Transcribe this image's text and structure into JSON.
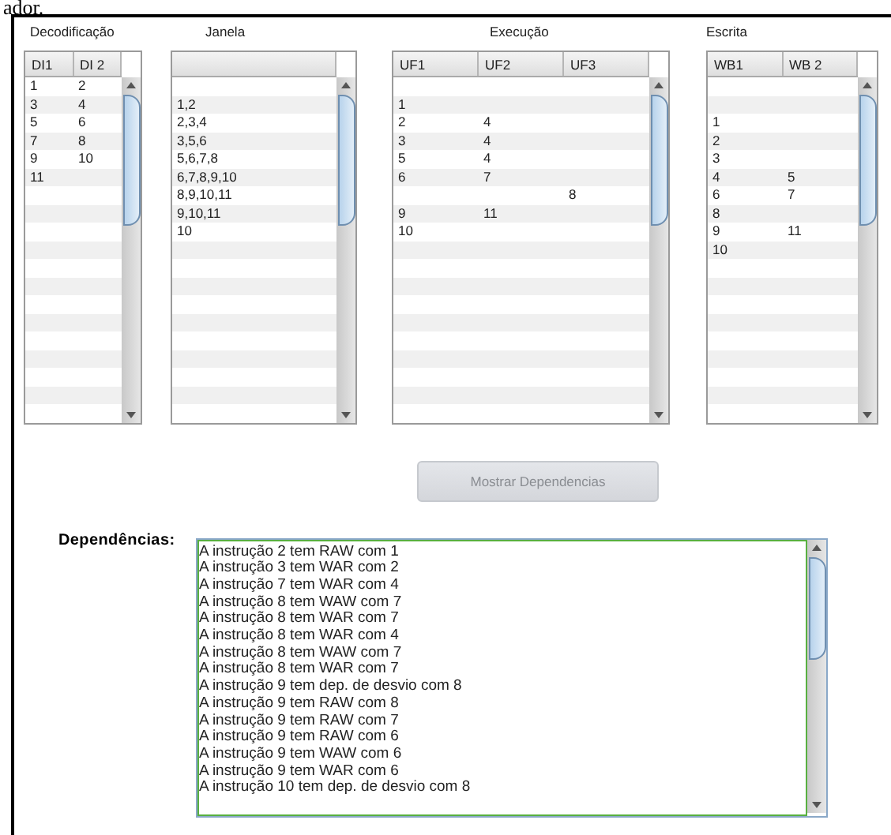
{
  "page_caption": "ador.",
  "tables": [
    {
      "caption": "Decodificação",
      "columns": [
        "DI1",
        "DI 2"
      ],
      "rows": [
        [
          "1",
          "2"
        ],
        [
          "3",
          "4"
        ],
        [
          "5",
          "6"
        ],
        [
          "7",
          "8"
        ],
        [
          "9",
          "10"
        ],
        [
          "11",
          null
        ]
      ]
    },
    {
      "caption": "Janela",
      "rows": [
        [
          null
        ],
        [
          "1,2"
        ],
        [
          "2,3,4"
        ],
        [
          "3,5,6"
        ],
        [
          "5,6,7,8"
        ],
        [
          "6,7,8,9,10"
        ],
        [
          "8,9,10,11"
        ],
        [
          "9,10,11"
        ],
        [
          "10"
        ]
      ]
    },
    {
      "caption": "Execução",
      "columns": [
        "UF1",
        "UF2",
        "UF3"
      ],
      "rows": [
        [
          null,
          null,
          null
        ],
        [
          "1",
          null,
          null
        ],
        [
          "2",
          "4",
          null
        ],
        [
          "3",
          "4",
          null
        ],
        [
          "5",
          "4",
          null
        ],
        [
          "6",
          "7",
          null
        ],
        [
          null,
          null,
          "8"
        ],
        [
          "9",
          "11",
          null
        ],
        [
          "10",
          null,
          null
        ]
      ]
    },
    {
      "caption": "Escrita",
      "columns": [
        "WB1",
        "WB 2"
      ],
      "rows": [
        [
          null,
          null
        ],
        [
          null,
          null
        ],
        [
          "1",
          null
        ],
        [
          "2",
          null
        ],
        [
          "3",
          null
        ],
        [
          "4",
          "5"
        ],
        [
          "6",
          "7"
        ],
        [
          "8",
          null
        ],
        [
          "9",
          "11"
        ],
        [
          "10",
          null
        ]
      ]
    }
  ],
  "button": {
    "label": "Mostrar Dependencias",
    "disabled": true
  },
  "dependencies": {
    "label": "Dependências:",
    "lines": [
      "A instrução 2 tem RAW com 1",
      "A instrução 3 tem WAR com 2",
      "A instrução 7 tem WAR com 4",
      "A instrução 8 tem WAW com 7",
      "A instrução 8 tem WAR com 7",
      "A instrução 8 tem WAR com 4",
      "A instrução 8 tem WAW com 7",
      "A instrução 8 tem WAR com 7",
      "A instrução 9 tem dep. de desvio com 8",
      "A instrução 9 tem RAW com 8",
      "A instrução 9 tem RAW com 7",
      "A instrução 9 tem RAW com 6",
      "A instrução 9 tem WAW com 6",
      "A instrução 9 tem WAR com 6",
      "A instrução 10 tem dep. de desvio com 8"
    ]
  }
}
